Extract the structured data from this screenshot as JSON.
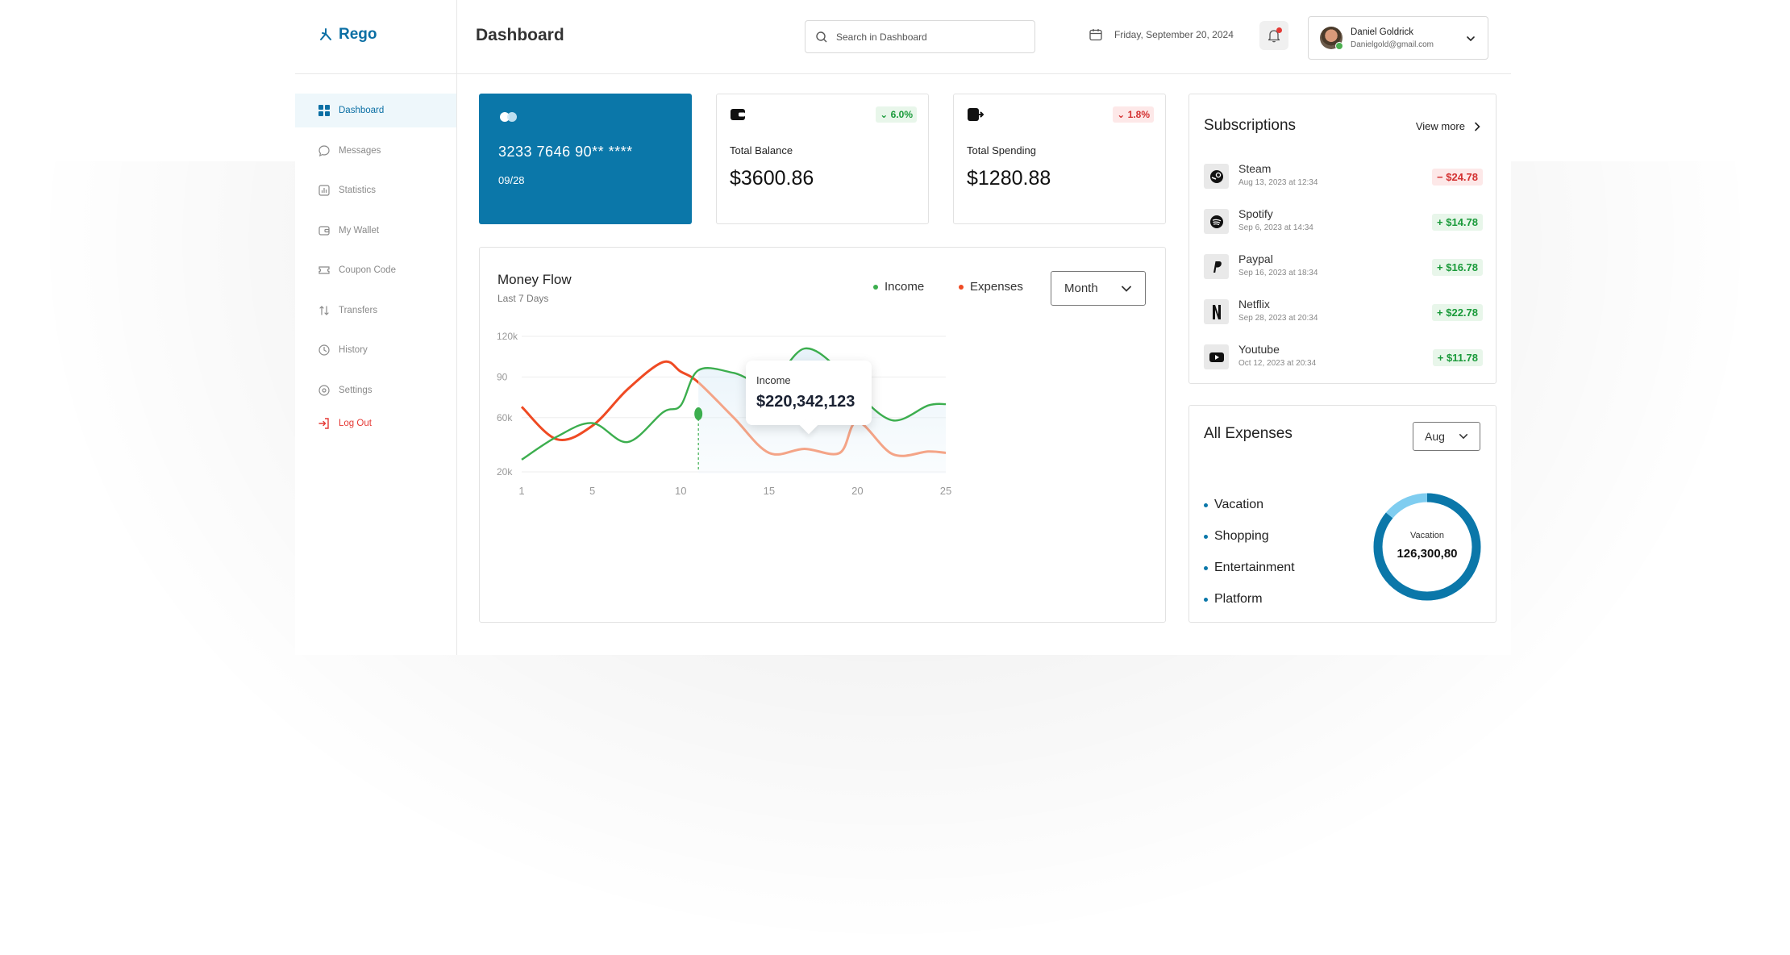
{
  "app": {
    "name": "Rego",
    "page_title": "Dashboard",
    "accent": "#0b77a9"
  },
  "header": {
    "search_placeholder": "Search in Dashboard",
    "date": "Friday, September 20, 2024",
    "user": {
      "name": "Daniel Goldrick",
      "email": "Danielgold@gmail.com"
    }
  },
  "sidebar": {
    "items": [
      {
        "label": "Dashboard",
        "icon": "grid-icon"
      },
      {
        "label": "Messages",
        "icon": "chat-icon"
      },
      {
        "label": "Statistics",
        "icon": "bar-chart-icon"
      },
      {
        "label": "My Wallet",
        "icon": "wallet-icon"
      },
      {
        "label": "Coupon Code",
        "icon": "coupon-icon"
      },
      {
        "label": "Transfers",
        "icon": "transfer-icon"
      },
      {
        "label": "History",
        "icon": "clock-icon"
      },
      {
        "label": "Settings",
        "icon": "settings-icon"
      },
      {
        "label": "Log Out",
        "icon": "logout-icon"
      }
    ]
  },
  "bank_card": {
    "number": "3233 7646 90** ****",
    "expiry": "09/28"
  },
  "stats": {
    "balance": {
      "label": "Total Balance",
      "value": "$3600.86",
      "change": "6.0%",
      "direction": "up"
    },
    "spending": {
      "label": "Total Spending",
      "value": "$1280.88",
      "change": "1.8%",
      "direction": "down"
    }
  },
  "money_flow": {
    "title": "Money Flow",
    "subtitle": "Last 7 Days",
    "legend": {
      "income": "Income",
      "expenses": "Expenses"
    },
    "period": "Month",
    "tooltip": {
      "label": "Income",
      "value": "$220,342,123"
    },
    "y_ticks": [
      "120k",
      "90",
      "60k",
      "20k"
    ],
    "x_ticks": [
      "1",
      "5",
      "10",
      "15",
      "20",
      "25"
    ],
    "colors": {
      "income": "#3cae4e",
      "expenses": "#ef4a23",
      "expenses_faded": "#f4a487"
    }
  },
  "chart_data": {
    "type": "line",
    "x": [
      1,
      3,
      5,
      7,
      9,
      10,
      11,
      13,
      15,
      17,
      19,
      20,
      22,
      24,
      25
    ],
    "series": [
      {
        "name": "Income",
        "values": [
          29,
          46,
          56,
          42,
          64,
          69,
          95,
          93,
          85,
          111,
          95,
          78,
          58,
          69,
          70
        ]
      },
      {
        "name": "Expenses",
        "values": [
          68,
          44,
          54,
          81,
          101,
          94,
          86,
          60,
          34,
          37,
          34,
          57,
          33,
          35,
          34
        ]
      }
    ],
    "ylim": [
      20,
      120
    ],
    "xlim": [
      1,
      25
    ],
    "highlight_x": 11
  },
  "subscriptions": {
    "title": "Subscriptions",
    "view_more": "View more",
    "items": [
      {
        "name": "Steam",
        "date": "Aug 13, 2023 at 12:34",
        "amount": "− $24.78",
        "type": "neg",
        "icon": "steam-icon"
      },
      {
        "name": "Spotify",
        "date": "Sep 6, 2023 at 14:34",
        "amount": "+ $14.78",
        "type": "pos",
        "icon": "spotify-icon"
      },
      {
        "name": "Paypal",
        "date": "Sep 16, 2023 at 18:34",
        "amount": "+ $16.78",
        "type": "pos",
        "icon": "paypal-icon"
      },
      {
        "name": "Netflix",
        "date": "Sep 28, 2023 at 20:34",
        "amount": "+ $22.78",
        "type": "pos",
        "icon": "netflix-icon"
      },
      {
        "name": "Youtube",
        "date": "Oct 12, 2023 at 20:34",
        "amount": "+ $11.78",
        "type": "pos",
        "icon": "youtube-icon"
      }
    ]
  },
  "expenses": {
    "title": "All Expenses",
    "period": "Aug",
    "categories": [
      "Vacation",
      "Shopping",
      "Entertainment",
      "Platform"
    ],
    "donut": {
      "label": "Vacation",
      "value": "126,300,80",
      "main_fraction": 0.86,
      "colors": [
        "#0b77a9",
        "#7fcdf0"
      ]
    }
  }
}
